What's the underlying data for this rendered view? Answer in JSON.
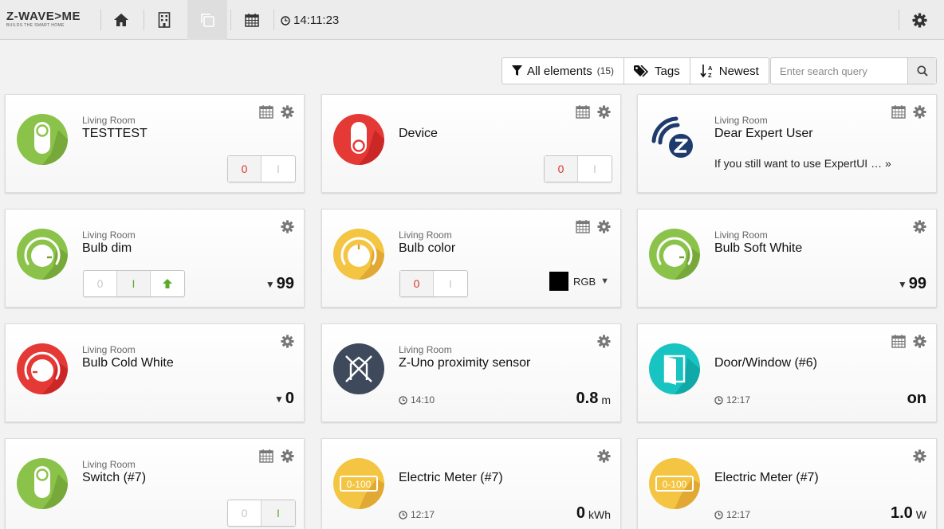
{
  "logo": {
    "main": "Z-WAVE>ME",
    "sub": "BUILDS THE SMART HOME"
  },
  "topbar": {
    "clock": "14:11:23"
  },
  "filters": {
    "all_label": "All elements",
    "all_count": "(15)",
    "tags_label": "Tags",
    "sort_label": "Newest",
    "search_placeholder": "Enter search query"
  },
  "colors": {
    "green": "#8bc34a",
    "red": "#e53935",
    "yellow": "#f4c542",
    "slate": "#3e4a5c",
    "teal": "#17c4c1"
  },
  "cards": [
    {
      "room": "Living Room",
      "title": "TESTTEST",
      "btn_off": "0",
      "btn_on": "I"
    },
    {
      "room": "",
      "title": "Device",
      "btn_off": "0",
      "btn_on": "I"
    },
    {
      "room": "Living Room",
      "title": "Dear Expert User",
      "desc": "If you still want to use ExpertUI … »"
    },
    {
      "room": "Living Room",
      "title": "Bulb dim",
      "btn_off": "0",
      "btn_on": "I",
      "level": "99"
    },
    {
      "room": "Living Room",
      "title": "Bulb color",
      "btn_off": "0",
      "btn_on": "I",
      "rgb": "RGB",
      "swatch": "#000000"
    },
    {
      "room": "Living Room",
      "title": "Bulb Soft White",
      "level": "99"
    },
    {
      "room": "Living Room",
      "title": "Bulb Cold White",
      "level": "0"
    },
    {
      "room": "Living Room",
      "title": "Z-Uno proximity sensor",
      "time": "14:10",
      "level": "0.8",
      "unit": "m"
    },
    {
      "room": "",
      "title": "Door/Window (#6)",
      "time": "12:17",
      "level": "on"
    },
    {
      "room": "Living Room",
      "title": "Switch (#7)",
      "btn_off": "0",
      "btn_on": "I"
    },
    {
      "room": "",
      "title": "Electric Meter (#7)",
      "time": "12:17",
      "level": "0",
      "unit": "kWh",
      "badge": "0-100"
    },
    {
      "room": "",
      "title": "Electric Meter (#7)",
      "time": "12:17",
      "level": "1.0",
      "unit": "W",
      "badge": "0-100"
    }
  ]
}
